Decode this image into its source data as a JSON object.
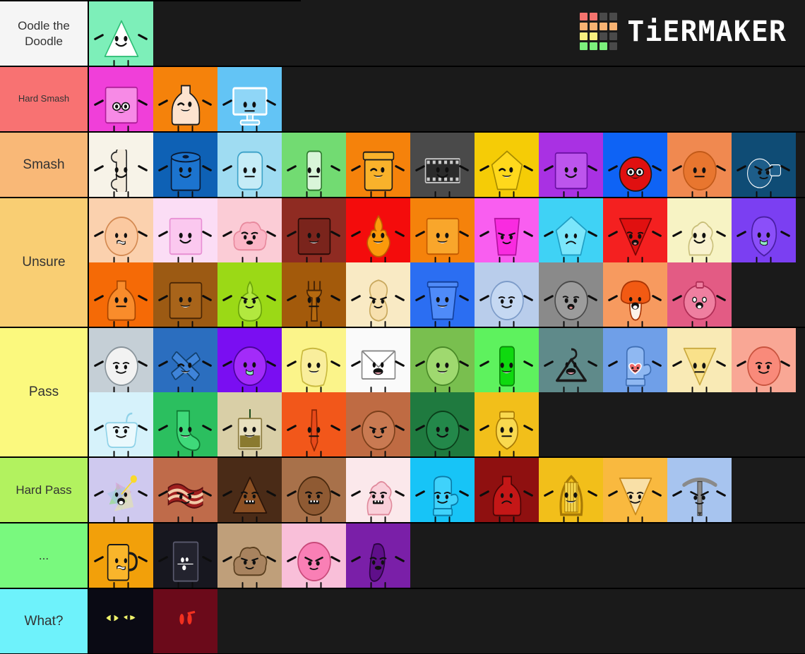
{
  "brand": {
    "name": "TiERMAKER",
    "logo_colors": [
      "#f4736e",
      "#f4736e",
      "#4a4a4a",
      "#4a4a4a",
      "#f7b272",
      "#f7b272",
      "#f7b272",
      "#f7b272",
      "#f7f080",
      "#f7f080",
      "#4a4a4a",
      "#4a4a4a",
      "#7cf07c",
      "#7cf07c",
      "#7cf07c",
      "#4a4a4a"
    ],
    "logo_icon": "tiermaker-grid-icon"
  },
  "layout": {
    "background": "#1a1a1a",
    "cell_size": 91,
    "label_width": 126,
    "border_color": "#000000"
  },
  "tiers": [
    {
      "label": "Oodle the Doodle",
      "label_size": "normal",
      "color": "#f5f5f5",
      "items": [
        {
          "name": "oodle-triangle",
          "bg": "#7defb9",
          "body": "#ffffff",
          "outline": "#2fbf77",
          "shape": "triangle",
          "face": "smile"
        }
      ]
    },
    {
      "label": "Hard Smash",
      "label_size": "small",
      "color": "#f87272",
      "items": [
        {
          "name": "pink-nerd-cup",
          "bg": "#f03fd9",
          "body": "#f78ae6",
          "outline": "#b01f9a",
          "shape": "rect",
          "face": "glasses"
        },
        {
          "name": "glue-bottle",
          "bg": "#f5820b",
          "body": "#fde3cf",
          "outline": "#1a1a1a",
          "shape": "bottle",
          "face": "wink"
        },
        {
          "name": "tv-monitor",
          "bg": "#63c4f5",
          "body": "#8fd6f7",
          "outline": "#ffffff",
          "shape": "screen",
          "face": "neutral"
        }
      ]
    },
    {
      "label": "Smash",
      "label_size": "big",
      "color": "#f9b877",
      "items": [
        {
          "name": "bone",
          "bg": "#f7f3e8",
          "body": "#f2eadb",
          "outline": "#2a2a2a",
          "shape": "bone",
          "face": "smile"
        },
        {
          "name": "blue-barrel",
          "bg": "#0e61b5",
          "body": "#1c74cf",
          "outline": "#0a1a33",
          "shape": "barrel",
          "face": "smile"
        },
        {
          "name": "ice-cube",
          "bg": "#9fdcf2",
          "body": "#c5ecf7",
          "outline": "#3fa3c9",
          "shape": "round-rect",
          "face": "neutral"
        },
        {
          "name": "leek-scallion",
          "bg": "#72db72",
          "body": "#d9f5d9",
          "outline": "#2f7a2f",
          "shape": "tall",
          "face": "neutral"
        },
        {
          "name": "honey-jar",
          "bg": "#f5820b",
          "body": "#f9b22b",
          "outline": "#1a1a1a",
          "shape": "jar",
          "face": "wink"
        },
        {
          "name": "film-strip",
          "bg": "#4a4a4a",
          "body": "#2a2a2a",
          "outline": "#cccccc",
          "shape": "film",
          "face": "smile"
        },
        {
          "name": "gold-gem-phone",
          "bg": "#f5cc06",
          "body": "#ffd91c",
          "outline": "#a88b00",
          "shape": "gem",
          "face": "wink"
        },
        {
          "name": "purple-block",
          "bg": "#a931e3",
          "body": "#bd55ed",
          "outline": "#6b10a3",
          "shape": "rect",
          "face": "smile"
        },
        {
          "name": "red-blue-glasses",
          "bg": "#0e63f5",
          "body": "#e01010",
          "outline": "#1a1a1a",
          "shape": "split",
          "face": "glasses"
        },
        {
          "name": "orange-circle",
          "bg": "#f08950",
          "body": "#e8762f",
          "outline": "#c25a19",
          "shape": "circle",
          "face": "neutral"
        },
        {
          "name": "navy-tool",
          "bg": "#0f4c75",
          "body": "#1d5d89",
          "outline": "#ffffff",
          "shape": "tool",
          "face": "angry"
        }
      ]
    },
    {
      "label": "Unsure",
      "label_size": "big",
      "color": "#f9ce73",
      "items": [
        {
          "name": "peach",
          "bg": "#fbd1ae",
          "body": "#fbc9a0",
          "outline": "#d48a52",
          "shape": "circle",
          "face": "worried"
        },
        {
          "name": "pink-marshmallow",
          "bg": "#fbddf5",
          "body": "#fbc8ef",
          "outline": "#e88fd4",
          "shape": "rect",
          "face": "smile"
        },
        {
          "name": "cotton-candy",
          "bg": "#fbccd6",
          "body": "#fbb6c6",
          "outline": "#e88a9e",
          "shape": "cloud",
          "face": "flat"
        },
        {
          "name": "dark-red-paper",
          "bg": "#8f2b22",
          "body": "#7a241c",
          "outline": "#2a0a06",
          "shape": "rect",
          "face": "grin"
        },
        {
          "name": "flame",
          "bg": "#f40c0c",
          "body": "#fb9a0b",
          "outline": "#c25a00",
          "shape": "flame",
          "face": "grin"
        },
        {
          "name": "orange-card",
          "bg": "#f5820b",
          "body": "#f9a62b",
          "outline": "#c45a00",
          "shape": "rect",
          "face": "grin"
        },
        {
          "name": "magenta-cup",
          "bg": "#f95ef0",
          "body": "#f92be0",
          "outline": "#b3129f",
          "shape": "cup",
          "face": "smug"
        },
        {
          "name": "cyan-gem",
          "bg": "#3fd2f5",
          "body": "#7be6fb",
          "outline": "#1f9ec4",
          "shape": "gem",
          "face": "sad"
        },
        {
          "name": "red-triangle",
          "bg": "#f42020",
          "body": "#e01010",
          "outline": "#7a0505",
          "shape": "tri-down",
          "face": "shocked"
        },
        {
          "name": "whipped-cream",
          "bg": "#f7f3c4",
          "body": "#f9f2cf",
          "outline": "#c9bf7a",
          "shape": "swirl",
          "face": "smile"
        },
        {
          "name": "purple-balloon",
          "bg": "#7b3ff2",
          "body": "#8b4ff9",
          "outline": "#4a1fa3",
          "shape": "balloon",
          "face": "tongue"
        },
        {
          "name": "orange-cone-bottle",
          "bg": "#f56a06",
          "body": "#f98c2b",
          "outline": "#a84500",
          "shape": "bottle",
          "face": "neutral"
        },
        {
          "name": "cardboard-box",
          "bg": "#9c5a13",
          "body": "#a8641a",
          "outline": "#4a2605",
          "shape": "rect",
          "face": "grin"
        },
        {
          "name": "green-pear",
          "bg": "#9bd916",
          "body": "#b2e83f",
          "outline": "#6ba30a",
          "shape": "pear",
          "face": "smug"
        },
        {
          "name": "brown-fork",
          "bg": "#a35a0b",
          "body": "#b5690f",
          "outline": "#4a2605",
          "shape": "fork",
          "face": "neutral"
        },
        {
          "name": "peanut",
          "bg": "#f9eac4",
          "body": "#f7e0ae",
          "outline": "#c9a95f",
          "shape": "peanut",
          "face": "smug"
        },
        {
          "name": "blue-bucket",
          "bg": "#2b6ef2",
          "body": "#4f8bf9",
          "outline": "#13409c",
          "shape": "bucket",
          "face": "grin"
        },
        {
          "name": "light-blue-plate",
          "bg": "#b9cdeb",
          "body": "#c5d8f2",
          "outline": "#7d9cc9",
          "shape": "circle",
          "face": "smirk"
        },
        {
          "name": "gray-ball",
          "bg": "#8a8a8a",
          "body": "#9c9c9c",
          "outline": "#4a4a4a",
          "shape": "circle",
          "face": "shocked"
        },
        {
          "name": "mushroom",
          "bg": "#f79a5f",
          "body": "#f25a13",
          "outline": "#a83505",
          "shape": "mushroom",
          "face": "shout"
        },
        {
          "name": "pink-perfume",
          "bg": "#e35b84",
          "body": "#ef7fa0",
          "outline": "#b02e56",
          "shape": "round",
          "face": "happy"
        }
      ]
    },
    {
      "label": "Pass",
      "label_size": "big",
      "color": "#fbf97e",
      "items": [
        {
          "name": "white-ball",
          "bg": "#c5cfd6",
          "body": "#f2f2f2",
          "outline": "#8a959c",
          "shape": "circle",
          "face": "smirk"
        },
        {
          "name": "blue-pinwheel",
          "bg": "#2b6ebf",
          "body": "#3f84d9",
          "outline": "#12406e",
          "shape": "pinwheel",
          "face": "wink"
        },
        {
          "name": "purple-orb",
          "bg": "#7a0ef2",
          "body": "#a32bf9",
          "outline": "#4a0599",
          "shape": "circle",
          "face": "tongue"
        },
        {
          "name": "yellow-cloth",
          "bg": "#fbf48a",
          "body": "#f9ee9c",
          "outline": "#c9b93f",
          "shape": "cloth",
          "face": "grin"
        },
        {
          "name": "envelope",
          "bg": "#fafafa",
          "body": "#ffffff",
          "outline": "#888888",
          "shape": "envelope",
          "face": "open"
        },
        {
          "name": "green-swirl",
          "bg": "#79bf4f",
          "body": "#9fd96f",
          "outline": "#4a8a28",
          "shape": "circle",
          "face": "grin"
        },
        {
          "name": "green-crayon",
          "bg": "#5ef25e",
          "body": "#0fd90f",
          "outline": "#0a8a0a",
          "shape": "tall",
          "face": "grin"
        },
        {
          "name": "hanger",
          "bg": "#5f8a8a",
          "body": "#5f8a8a",
          "outline": "#1a1a1a",
          "shape": "hanger",
          "face": "open"
        },
        {
          "name": "blue-mitten",
          "bg": "#6f9fe8",
          "body": "#8fb8f2",
          "outline": "#3f6fb5",
          "shape": "mitten",
          "face": "love"
        },
        {
          "name": "yellow-chip",
          "bg": "#f9eab5",
          "body": "#f9e18a",
          "outline": "#c9a93f",
          "shape": "tri-down",
          "face": "neutral"
        },
        {
          "name": "pink-ball",
          "bg": "#f9a795",
          "body": "#f98a7a",
          "outline": "#c9543f",
          "shape": "circle",
          "face": "smirk"
        },
        {
          "name": "bathtub",
          "bg": "#d6f2fb",
          "body": "#eaf9fd",
          "outline": "#8fd2e8",
          "shape": "tub",
          "face": "smirk"
        },
        {
          "name": "green-sock",
          "bg": "#2bbf5f",
          "body": "#3fd97a",
          "outline": "#0f7a33",
          "shape": "sock",
          "face": "grin"
        },
        {
          "name": "tea-bag",
          "bg": "#d9cfa7",
          "body": "#e8e0bf",
          "outline": "#8a7a3f",
          "shape": "teabag",
          "face": "grin"
        },
        {
          "name": "orange-pen",
          "bg": "#f2571a",
          "body": "#e8491a",
          "outline": "#8a2505",
          "shape": "pen",
          "face": "neutral"
        },
        {
          "name": "yarn-ball-brown",
          "bg": "#bf6b43",
          "body": "#c97a52",
          "outline": "#7a3f1a",
          "shape": "circle",
          "face": "smug"
        },
        {
          "name": "yarn-ball-green",
          "bg": "#1f7a3f",
          "body": "#23884a",
          "outline": "#0a3f1a",
          "shape": "circle",
          "face": "smile"
        },
        {
          "name": "yellow-bulb",
          "bg": "#f2bf1a",
          "body": "#f9d94f",
          "outline": "#a87a05",
          "shape": "bulb",
          "face": "neutral"
        }
      ]
    },
    {
      "label": "Hard Pass",
      "label_size": "normal",
      "color": "#b2f25f",
      "items": [
        {
          "name": "party-hat-confetti",
          "bg": "#cfc9ef",
          "body": "#9fd99f",
          "outline": "#1a1a1a",
          "shape": "confetti",
          "face": "shout"
        },
        {
          "name": "bacon",
          "bg": "#bf6b4a",
          "body": "#a01f1f",
          "outline": "#5a0f0f",
          "shape": "bacon",
          "face": "smug"
        },
        {
          "name": "chocolate-cone",
          "bg": "#4a2b17",
          "body": "#8a4f23",
          "outline": "#2a1408",
          "shape": "triangle",
          "face": "teeth"
        },
        {
          "name": "cookie-ball",
          "bg": "#a8714a",
          "body": "#8f5a33",
          "outline": "#4a2a0f",
          "shape": "circle",
          "face": "teeth"
        },
        {
          "name": "pink-whipped",
          "bg": "#fbe8eb",
          "body": "#f9cfd9",
          "outline": "#e08a9c",
          "shape": "swirl",
          "face": "teeth"
        },
        {
          "name": "blue-glove",
          "bg": "#17c4f7",
          "body": "#3fd2fb",
          "outline": "#0a7ba8",
          "shape": "mitten",
          "face": "smirk"
        },
        {
          "name": "ketchup-bottle",
          "bg": "#8f1010",
          "body": "#c41717",
          "outline": "#4a0505",
          "shape": "bottle",
          "face": "sad"
        },
        {
          "name": "golden-harp",
          "bg": "#f2bf1a",
          "body": "#f9d94f",
          "outline": "#a87a05",
          "shape": "harp",
          "face": "grin"
        },
        {
          "name": "nacho-chip",
          "bg": "#f9b93f",
          "body": "#f9e0a7",
          "outline": "#c98a1a",
          "shape": "tri-down",
          "face": "smirk"
        },
        {
          "name": "pickaxe",
          "bg": "#a7c4ef",
          "body": "#8a8a8a",
          "outline": "#3f3f3f",
          "shape": "pickaxe",
          "face": "angry"
        }
      ]
    },
    {
      "label": "...",
      "label_size": "normal",
      "color": "#79f97e",
      "items": [
        {
          "name": "orange-mug",
          "bg": "#f2a00a",
          "body": "#f9b52b",
          "outline": "#1a1a1a",
          "shape": "mug",
          "face": "worried"
        },
        {
          "name": "domino",
          "bg": "#17171f",
          "body": "#23232e",
          "outline": "#5a5a6e",
          "shape": "domino",
          "face": "dots"
        },
        {
          "name": "muffin-top",
          "bg": "#bf9f7a",
          "body": "#a8835f",
          "outline": "#5a3f1f",
          "shape": "cloud",
          "face": "smug"
        },
        {
          "name": "pink-blob-angry",
          "bg": "#f9bfd9",
          "body": "#f97fb5",
          "outline": "#c94a7a",
          "shape": "circle",
          "face": "angry"
        },
        {
          "name": "purple-figure",
          "bg": "#7a1fa8",
          "body": "#5f0f8a",
          "outline": "#2a0540",
          "shape": "figure",
          "face": "flat"
        }
      ]
    },
    {
      "label": "What?",
      "label_size": "big",
      "color": "#6ef2fb",
      "items": [
        {
          "name": "dark-cat-eyes",
          "bg": "#0a0a14",
          "body": "#0a0a14",
          "outline": "#0a0a14",
          "shape": "dark",
          "face": "cat-eyes"
        },
        {
          "name": "red-glow-eyes",
          "bg": "#6b0a1a",
          "body": "#6b0a1a",
          "outline": "#6b0a1a",
          "shape": "dark",
          "face": "red-eyes"
        }
      ]
    }
  ]
}
